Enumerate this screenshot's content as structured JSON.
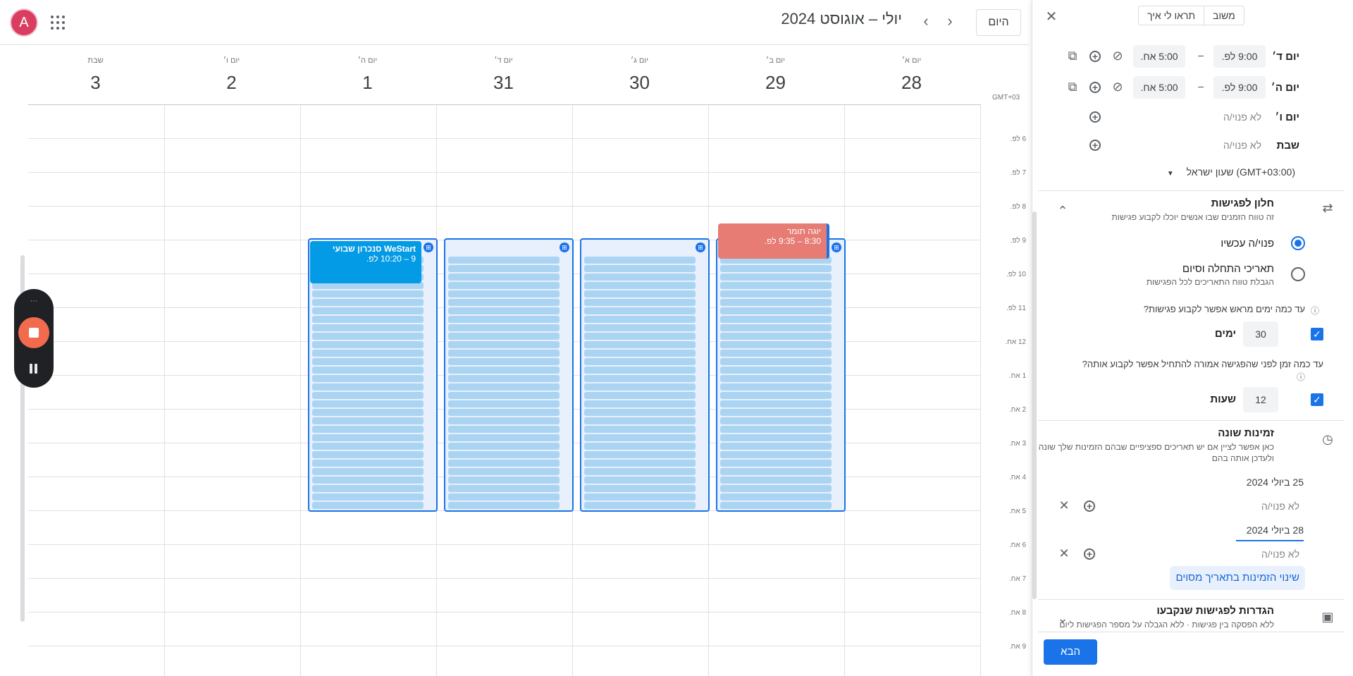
{
  "header": {
    "avatar_letter": "A",
    "title": "יולי – אוגוסט 2024",
    "today_label": "היום",
    "prev_icon": "chevron-left-icon",
    "next_icon": "chevron-right-icon"
  },
  "days": [
    {
      "name": "יום א׳",
      "num": "28"
    },
    {
      "name": "יום ב׳",
      "num": "29"
    },
    {
      "name": "יום ג׳",
      "num": "30"
    },
    {
      "name": "יום ד׳",
      "num": "31"
    },
    {
      "name": "יום ה׳",
      "num": "1"
    },
    {
      "name": "יום ו׳",
      "num": "2"
    },
    {
      "name": "שבת",
      "num": "3"
    }
  ],
  "timezone_label": "GMT+03",
  "hours": [
    "6 לפ.",
    "7 לפ.",
    "8 לפ.",
    "9 לפ.",
    "10 לפ.",
    "11 לפ.",
    "12 אח.",
    "1 אח.",
    "2 אח.",
    "3 אח.",
    "4 אח.",
    "5 אח.",
    "6 אח.",
    "7 אח.",
    "8 אח.",
    "9 אח."
  ],
  "events": [
    {
      "title": "יוגה תומר",
      "time": "8:30 – 9:35 לפ."
    },
    {
      "title": "WeStart סנכרון שבועי",
      "time": "9 – 10:20 לפ."
    }
  ],
  "panel": {
    "tab_feedback": "משוב",
    "tab_show_me": "תראו לי איך",
    "rows": [
      {
        "day": "יום ד׳",
        "start": "9:00 לפ.",
        "end": "5:00 אח."
      },
      {
        "day": "יום ה׳",
        "start": "9:00 לפ.",
        "end": "5:00 אח."
      }
    ],
    "unavailable_rows": [
      {
        "day": "יום ו׳",
        "text": "לא פנוי/ה"
      },
      {
        "day": "שבת",
        "text": "לא פנוי/ה"
      }
    ],
    "dash": "–",
    "timezone_select": "(GMT+03:00) שעון ישראל",
    "booking_window": {
      "title": "חלון לפגישות",
      "subtitle": "זה טווח הזמנים שבו אנשים יוכלו לקבוע פגישות",
      "opt_now": "פנוי/ה עכשיו",
      "opt_dates": "תאריכי התחלה וסיום",
      "opt_dates_sub": "הגבלת טווח התאריכים לכל הפגישות",
      "days_ahead_q": "עד כמה ימים מראש אפשר לקבוע פגישות?",
      "days_value": "30",
      "days_unit": "ימים",
      "hours_before_q": "עד כמה זמן לפני שהפגישה אמורה להתחיל אפשר לקבוע אותה?",
      "hours_value": "12",
      "hours_unit": "שעות"
    },
    "adjusted": {
      "title": "זמינות שונה",
      "subtitle": "כאן אפשר לציין אם יש תאריכים ספציפיים שבהם הזמינות שלך שונה ולעדכן אותה בהם",
      "dates": [
        {
          "date": "25 ביולי 2024",
          "status": "לא פנוי/ה"
        },
        {
          "date": "28 ביולי 2024",
          "status": "לא פנוי/ה"
        }
      ],
      "change_button": "שינוי הזמינות בתאריך מסוים"
    },
    "booked": {
      "title": "הגדרות לפגישות שנקבעו",
      "subtitle": "ללא הפסקה בין פגישות · ללא הגבלה על מספר הפגישות ליום"
    },
    "next_button": "הבא"
  },
  "colors": {
    "accent": "#1a73e8",
    "event_yoga": "#e67c73",
    "event_sync": "#039be5",
    "slot": "#aad4f2",
    "record": "#f26b4f"
  }
}
